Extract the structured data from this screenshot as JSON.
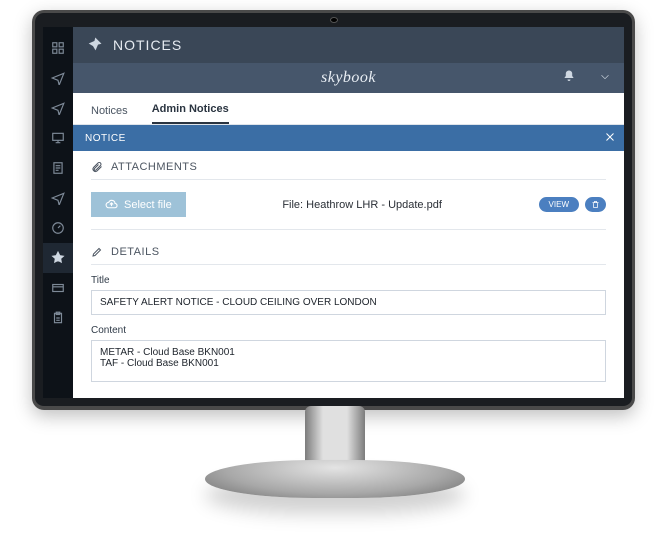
{
  "brand": "skybook",
  "pageTitle": "NOTICES",
  "tabs": [
    {
      "label": "Notices",
      "active": false
    },
    {
      "label": "Admin Notices",
      "active": true
    }
  ],
  "noticeHeader": "NOTICE",
  "sections": {
    "attachments": {
      "heading": "ATTACHMENTS",
      "selectFileLabel": "Select file",
      "fileLabel": "File: Heathrow LHR - Update.pdf",
      "viewChip": "VIEW"
    },
    "details": {
      "heading": "DETAILS",
      "titleLabel": "Title",
      "titleValue": "SAFETY ALERT NOTICE - CLOUD CEILING OVER LONDON",
      "contentLabel": "Content",
      "contentValue": "METAR - Cloud Base BKN001\nTAF - Cloud Base BKN001"
    }
  }
}
